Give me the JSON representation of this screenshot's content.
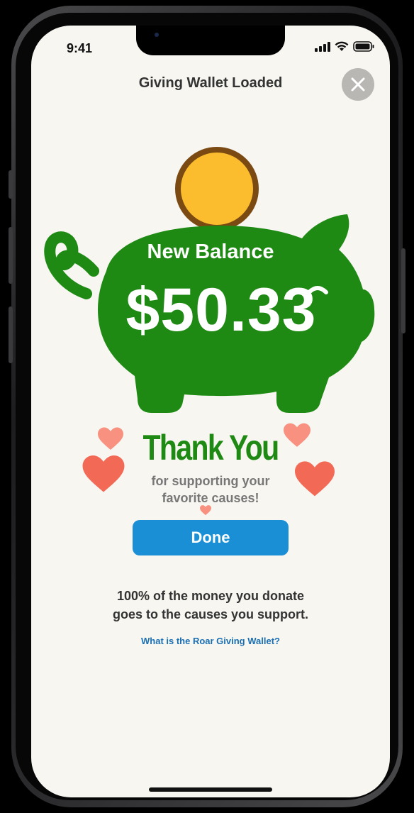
{
  "status_bar": {
    "time": "9:41",
    "icons": [
      "cellular-signal-icon",
      "wifi-icon",
      "battery-icon"
    ]
  },
  "header": {
    "title": "Giving Wallet Loaded",
    "close_icon": "close-icon"
  },
  "balance": {
    "label": "New Balance",
    "amount": "$50.33"
  },
  "thank_you": {
    "title": "Thank You",
    "subtitle_line1": "for supporting your",
    "subtitle_line2": "favorite causes!"
  },
  "actions": {
    "done_label": "Done"
  },
  "footer": {
    "note_line1": "100% of the money you donate",
    "note_line2": "goes to the causes you support.",
    "link_text": "What is the Roar Giving Wallet?"
  },
  "colors": {
    "pig_green": "#1e8a14",
    "coin_gold": "#fbbd2e",
    "coin_rim": "#7a4a12",
    "heart_coral": "#f26a55",
    "heart_light": "#f8917f",
    "button_blue": "#1a8fd6",
    "link_blue": "#1a6fb3",
    "background": "#f8f6f1"
  }
}
